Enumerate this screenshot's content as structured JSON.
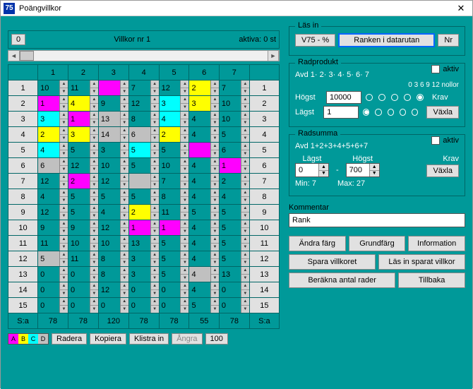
{
  "window": {
    "icon_text": "75",
    "title": "Poängvillkor"
  },
  "header": {
    "nr_btn": "0",
    "villkor_label": "Villkor nr 1",
    "aktiva_label": "aktiva: 0 st"
  },
  "grid": {
    "cols": [
      "1",
      "2",
      "3",
      "4",
      "5",
      "6",
      "7"
    ],
    "rows": [
      {
        "n": "1",
        "cells": [
          {
            "v": "10"
          },
          {
            "v": "11"
          },
          {
            "v": "",
            "c": "magenta"
          },
          {
            "v": "7"
          },
          {
            "v": "12"
          },
          {
            "v": "2",
            "c": "yellow"
          },
          {
            "v": "7"
          }
        ]
      },
      {
        "n": "2",
        "cells": [
          {
            "v": "1",
            "c": "magenta"
          },
          {
            "v": "4",
            "c": "yellow"
          },
          {
            "v": "9"
          },
          {
            "v": "12"
          },
          {
            "v": "3",
            "c": "cyan"
          },
          {
            "v": "3",
            "c": "yellow"
          },
          {
            "v": "10"
          }
        ]
      },
      {
        "n": "3",
        "cells": [
          {
            "v": "3",
            "c": "cyan"
          },
          {
            "v": "1",
            "c": "magenta"
          },
          {
            "v": "13",
            "c": "gray"
          },
          {
            "v": "8"
          },
          {
            "v": "4",
            "c": "cyan"
          },
          {
            "v": "4"
          },
          {
            "v": "10"
          }
        ]
      },
      {
        "n": "4",
        "cells": [
          {
            "v": "2",
            "c": "yellow"
          },
          {
            "v": "3",
            "c": "yellow"
          },
          {
            "v": "14",
            "c": "gray"
          },
          {
            "v": "6",
            "c": "gray"
          },
          {
            "v": "2",
            "c": "yellow"
          },
          {
            "v": "4"
          },
          {
            "v": "5"
          }
        ]
      },
      {
        "n": "5",
        "cells": [
          {
            "v": "4",
            "c": "cyan"
          },
          {
            "v": "5"
          },
          {
            "v": "3"
          },
          {
            "v": "5",
            "c": "cyan"
          },
          {
            "v": "5"
          },
          {
            "v": "",
            "c": "magenta"
          },
          {
            "v": "6"
          }
        ]
      },
      {
        "n": "6",
        "cells": [
          {
            "v": "6",
            "c": "gray"
          },
          {
            "v": "12"
          },
          {
            "v": "10"
          },
          {
            "v": "5"
          },
          {
            "v": "10"
          },
          {
            "v": "4"
          },
          {
            "v": "1",
            "c": "magenta"
          }
        ]
      },
      {
        "n": "7",
        "cells": [
          {
            "v": "12"
          },
          {
            "v": "2",
            "c": "magenta"
          },
          {
            "v": "12"
          },
          {
            "v": "",
            "c": "gray"
          },
          {
            "v": "7"
          },
          {
            "v": "4"
          },
          {
            "v": "2"
          }
        ]
      },
      {
        "n": "8",
        "cells": [
          {
            "v": "4"
          },
          {
            "v": "5"
          },
          {
            "v": "5"
          },
          {
            "v": "5"
          },
          {
            "v": "8"
          },
          {
            "v": "4"
          },
          {
            "v": "4"
          }
        ]
      },
      {
        "n": "9",
        "cells": [
          {
            "v": "12"
          },
          {
            "v": "5"
          },
          {
            "v": "4"
          },
          {
            "v": "2",
            "c": "yellow"
          },
          {
            "v": "11"
          },
          {
            "v": "5"
          },
          {
            "v": "5"
          }
        ]
      },
      {
        "n": "10",
        "cells": [
          {
            "v": "9"
          },
          {
            "v": "9"
          },
          {
            "v": "12"
          },
          {
            "v": "1",
            "c": "magenta"
          },
          {
            "v": "1",
            "c": "magenta"
          },
          {
            "v": "4"
          },
          {
            "v": "5"
          }
        ]
      },
      {
        "n": "11",
        "cells": [
          {
            "v": "11"
          },
          {
            "v": "10"
          },
          {
            "v": "10"
          },
          {
            "v": "13"
          },
          {
            "v": "5"
          },
          {
            "v": "4"
          },
          {
            "v": "5"
          }
        ]
      },
      {
        "n": "12",
        "cells": [
          {
            "v": "5",
            "c": "gray"
          },
          {
            "v": "11"
          },
          {
            "v": "8"
          },
          {
            "v": "3"
          },
          {
            "v": "5"
          },
          {
            "v": "4"
          },
          {
            "v": "5"
          }
        ]
      },
      {
        "n": "13",
        "cells": [
          {
            "v": "0"
          },
          {
            "v": "0"
          },
          {
            "v": "8"
          },
          {
            "v": "3"
          },
          {
            "v": "5"
          },
          {
            "v": "4",
            "c": "gray"
          },
          {
            "v": "13"
          }
        ]
      },
      {
        "n": "14",
        "cells": [
          {
            "v": "0"
          },
          {
            "v": "0"
          },
          {
            "v": "12"
          },
          {
            "v": "0"
          },
          {
            "v": "0"
          },
          {
            "v": "4"
          },
          {
            "v": "0"
          }
        ]
      },
      {
        "n": "15",
        "cells": [
          {
            "v": "0"
          },
          {
            "v": "0"
          },
          {
            "v": "0"
          },
          {
            "v": "0"
          },
          {
            "v": "0"
          },
          {
            "v": "5"
          },
          {
            "v": "0"
          }
        ]
      }
    ],
    "sum_label": "S:a",
    "sums": [
      "78",
      "78",
      "120",
      "78",
      "78",
      "55",
      "78"
    ]
  },
  "bottom": {
    "swatches": [
      "A",
      "B",
      "C",
      "D"
    ],
    "radera": "Radera",
    "kopiera": "Kopiera",
    "klistra": "Klistra in",
    "angra": "Ångra",
    "hundra": "100"
  },
  "lasin": {
    "legend": "Läs in",
    "v75": "V75 - %",
    "ranken": "Ranken i datarutan",
    "nr": "Nr"
  },
  "radprodukt": {
    "legend": "Radprodukt",
    "aktiv": "aktiv",
    "avd": "Avd  1· 2· 3· 4· 5· 6· 7",
    "nollor_hdr": "0  3  6  9  12 nollor",
    "hogst": "Högst",
    "hogst_val": "10000",
    "lagst": "Lägst",
    "lagst_val": "1",
    "krav": "Krav",
    "vaxla": "Växla"
  },
  "radsumma": {
    "legend": "Radsumma",
    "aktiv": "aktiv",
    "avd": "Avd 1+2+3+4+5+6+7",
    "lagst": "Lägst",
    "lagst_val": "0",
    "hogst": "Högst",
    "hogst_val": "700",
    "min": "Min: 7",
    "max": "Max: 27",
    "krav": "Krav",
    "vaxla": "Växla"
  },
  "kommentar": {
    "label": "Kommentar",
    "value": "Rank"
  },
  "buttons": {
    "andra_farg": "Ändra färg",
    "grundfarg": "Grundfärg",
    "information": "Information",
    "spara": "Spara villkoret",
    "las_sparat": "Läs in sparat villkor",
    "berakna": "Beräkna antal rader",
    "tillbaka": "Tillbaka"
  }
}
